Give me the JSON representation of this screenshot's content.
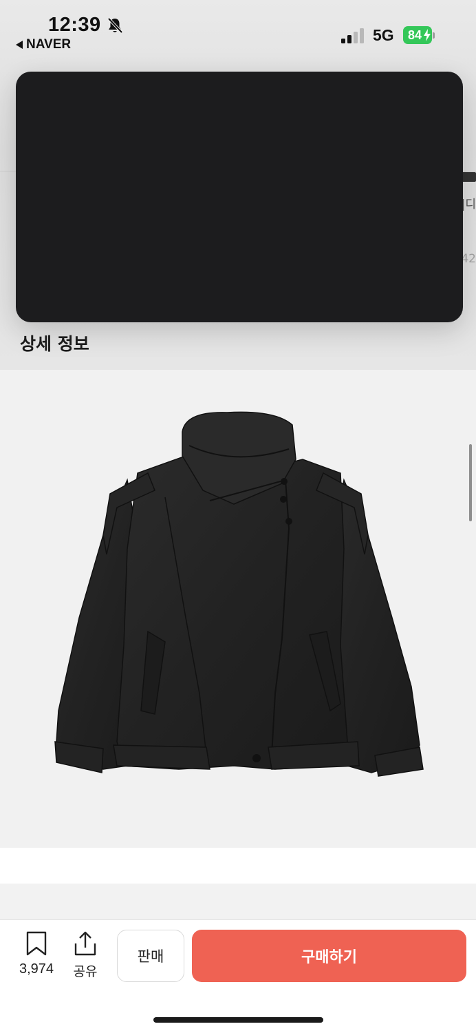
{
  "status_bar": {
    "time": "12:39",
    "back_app": "NAVER",
    "network": "5G",
    "battery": "84"
  },
  "background": {
    "peek_text_1": "|디",
    "peek_text_2": "42"
  },
  "section": {
    "title": "상세 정보"
  },
  "bottom_bar": {
    "bookmark_count": "3,974",
    "share_label": "공유",
    "sell_label": "판매",
    "buy_label": "구매하기"
  },
  "colors": {
    "buy_button": "#ef6253",
    "battery": "#34c759",
    "overlay": "#1c1c1e"
  },
  "icons": [
    "bell-off-icon",
    "back-arrow-icon",
    "signal-icon",
    "bolt-icon",
    "bookmark-icon",
    "share-icon"
  ]
}
